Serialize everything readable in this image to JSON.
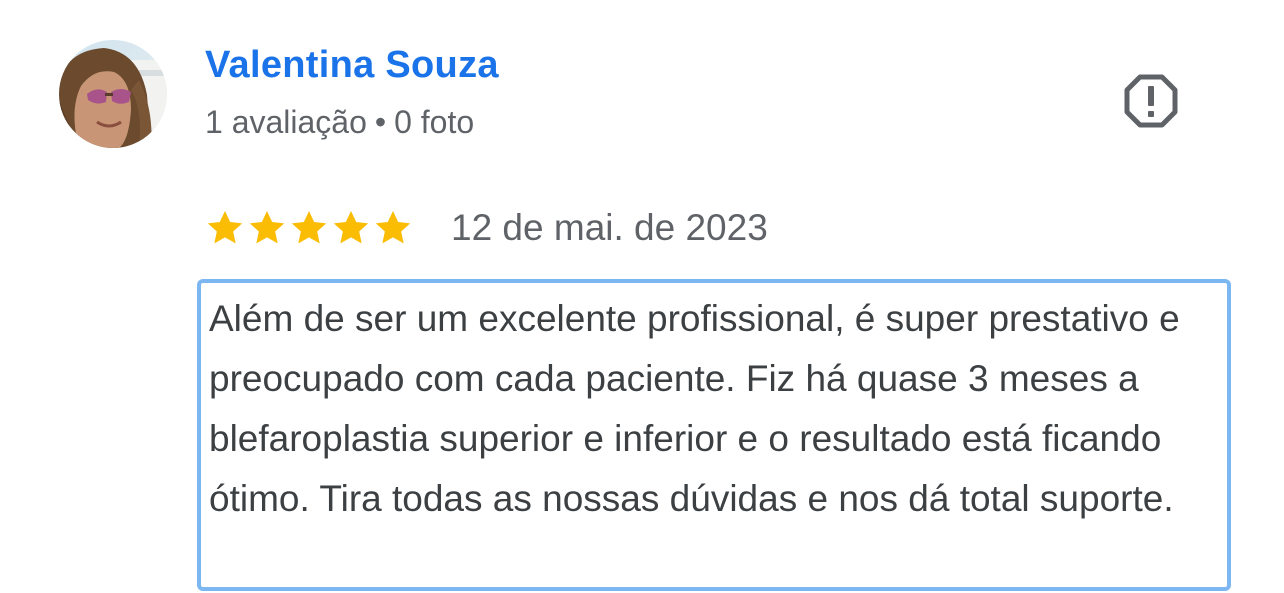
{
  "reviewer": {
    "name": "Valentina Souza",
    "reviews_count": "1 avaliação",
    "separator": "•",
    "photos_count": "0 foto",
    "avatar_icon": "avatar-photo"
  },
  "actions": {
    "report_icon": "report-flag-icon"
  },
  "review": {
    "rating": 5,
    "max_rating": 5,
    "date": "12 de mai. de 2023",
    "text": "Além de ser um excelente profissional, é super prestativo e preocupado com cada paciente. Fiz há quase 3 meses a blefaroplastia superior e inferior e o resultado está ficando ótimo. Tira todas as nossas dúvidas e nos dá total suporte."
  },
  "colors": {
    "name": "#1a73e8",
    "star": "#fbbc04",
    "meta": "#5f6368",
    "text": "#3c4043",
    "highlight_border": "#7db7f2"
  }
}
